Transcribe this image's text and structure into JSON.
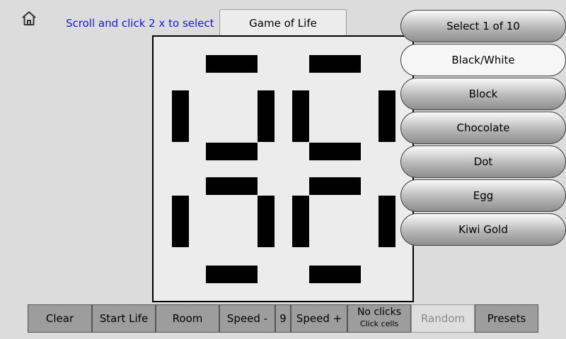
{
  "header": {
    "home_icon": "home-icon",
    "hint": "Scroll and click 2 x to select",
    "title": "Game of Life"
  },
  "presets": {
    "items": [
      {
        "label": "Select 1 of 10",
        "selected": false
      },
      {
        "label": "Black/White",
        "selected": true
      },
      {
        "label": "Block",
        "selected": false
      },
      {
        "label": "Chocolate",
        "selected": false
      },
      {
        "label": "Dot",
        "selected": false
      },
      {
        "label": "Egg",
        "selected": false
      },
      {
        "label": "Kiwi Gold",
        "selected": false
      }
    ]
  },
  "toolbar": {
    "clear": "Clear",
    "start_life": "Start Life",
    "room": "Room",
    "speed_minus": "Speed -",
    "speed_value": "9",
    "speed_plus": "Speed +",
    "no_clicks": "No clicks",
    "click_cells": "Click cells",
    "random": "Random",
    "presets": "Presets"
  },
  "colors": {
    "hint": "#1515e6",
    "live_cell": "#000000",
    "grid_background": "#ececec",
    "page_background": "#dcdcdc"
  }
}
